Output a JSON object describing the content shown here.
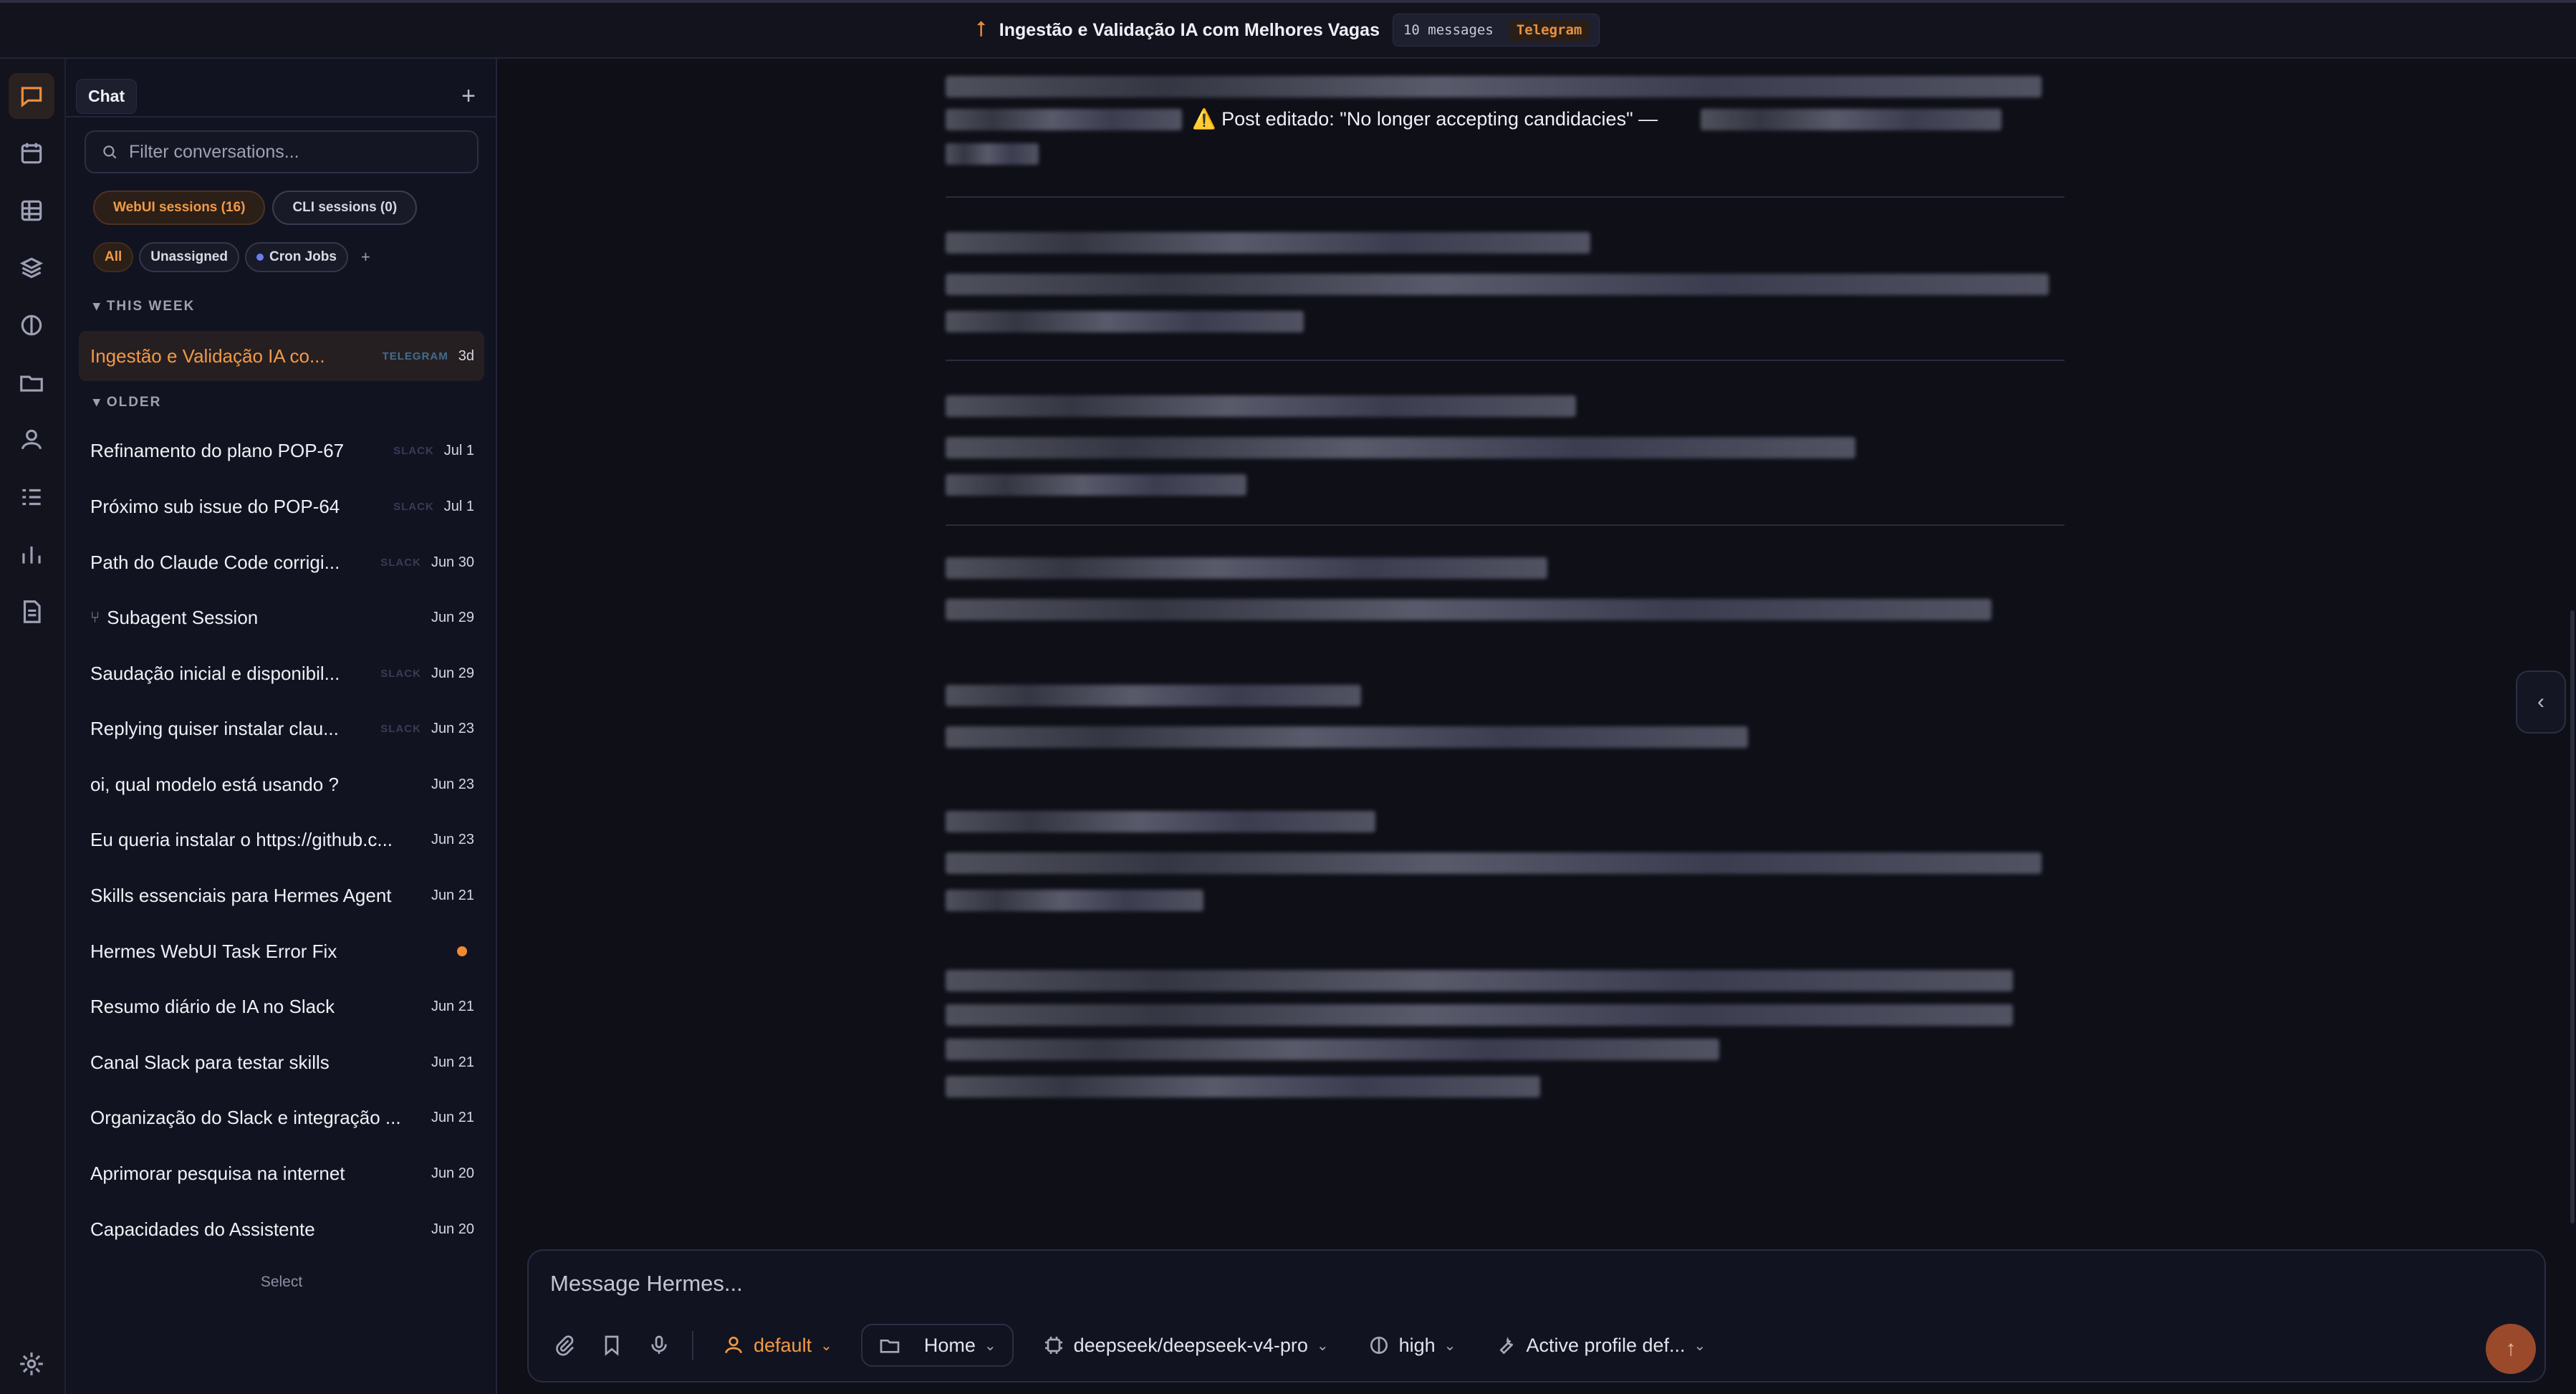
{
  "header": {
    "title": "Ingestão e Validação IA com Melhores Vagas",
    "message_count": "10 messages",
    "source": "Telegram"
  },
  "rail": {
    "items": [
      "chat-icon",
      "calendar-icon",
      "grid-icon",
      "layers-icon",
      "brain-icon",
      "folder-icon",
      "user-icon",
      "tasks-icon",
      "chart-icon",
      "document-icon",
      "settings-icon"
    ]
  },
  "sidebar": {
    "tab_label": "Chat",
    "new_label": "+",
    "search_placeholder": "Filter conversations...",
    "session_tabs": [
      "WebUI sessions (16)",
      "CLI sessions (0)"
    ],
    "filters": [
      "All",
      "Unassigned",
      "Cron Jobs",
      "+"
    ],
    "this_week_label": "THIS WEEK",
    "older_label": "OLDER",
    "active": {
      "title": "Ingestão e Validação IA co...",
      "source": "TELEGRAM",
      "date": "3d"
    },
    "conversations": [
      {
        "title": "Refinamento do plano POP-67",
        "source": "SLACK",
        "date": "Jul 1"
      },
      {
        "title": "Próximo sub issue do POP-64",
        "source": "SLACK",
        "date": "Jul 1"
      },
      {
        "title": "Path do Claude Code corrigi...",
        "source": "SLACK",
        "date": "Jun 30"
      },
      {
        "title": "Subagent Session",
        "source": "",
        "date": "Jun 29"
      },
      {
        "title": "Saudação inicial e disponibil...",
        "source": "SLACK",
        "date": "Jun 29"
      },
      {
        "title": "Replying quiser instalar clau...",
        "source": "SLACK",
        "date": "Jun 23"
      },
      {
        "title": "oi, qual modelo está usando ?",
        "source": "",
        "date": "Jun 23"
      },
      {
        "title": "Eu queria instalar o https://github.c...",
        "source": "",
        "date": "Jun 23"
      },
      {
        "title": "Skills essenciais para Hermes Agent",
        "source": "",
        "date": "Jun 21"
      },
      {
        "title": "Hermes WebUI Task Error Fix",
        "source": "",
        "date": ""
      },
      {
        "title": "Resumo diário de IA no Slack",
        "source": "",
        "date": "Jun 21"
      },
      {
        "title": "Canal Slack para testar skills",
        "source": "",
        "date": "Jun 21"
      },
      {
        "title": "Organização do Slack e integração ...",
        "source": "",
        "date": "Jun 21"
      },
      {
        "title": "Aprimorar pesquisa na internet",
        "source": "",
        "date": "Jun 20"
      },
      {
        "title": "Capacidades do Assistente",
        "source": "",
        "date": "Jun 20"
      }
    ],
    "select_label": "Select"
  },
  "main": {
    "visible_text": "⚠️ Post editado: \"No longer accepting candidacies\" —"
  },
  "composer": {
    "placeholder": "Message Hermes...",
    "profile": "default",
    "workspace": "Home",
    "model": "deepseek/deepseek-v4-pro",
    "reasoning": "high",
    "toolset": "Active profile def..."
  },
  "colors": {
    "accent": "#f09a46",
    "background": "#0e0f17",
    "sidebar": "#121320"
  }
}
